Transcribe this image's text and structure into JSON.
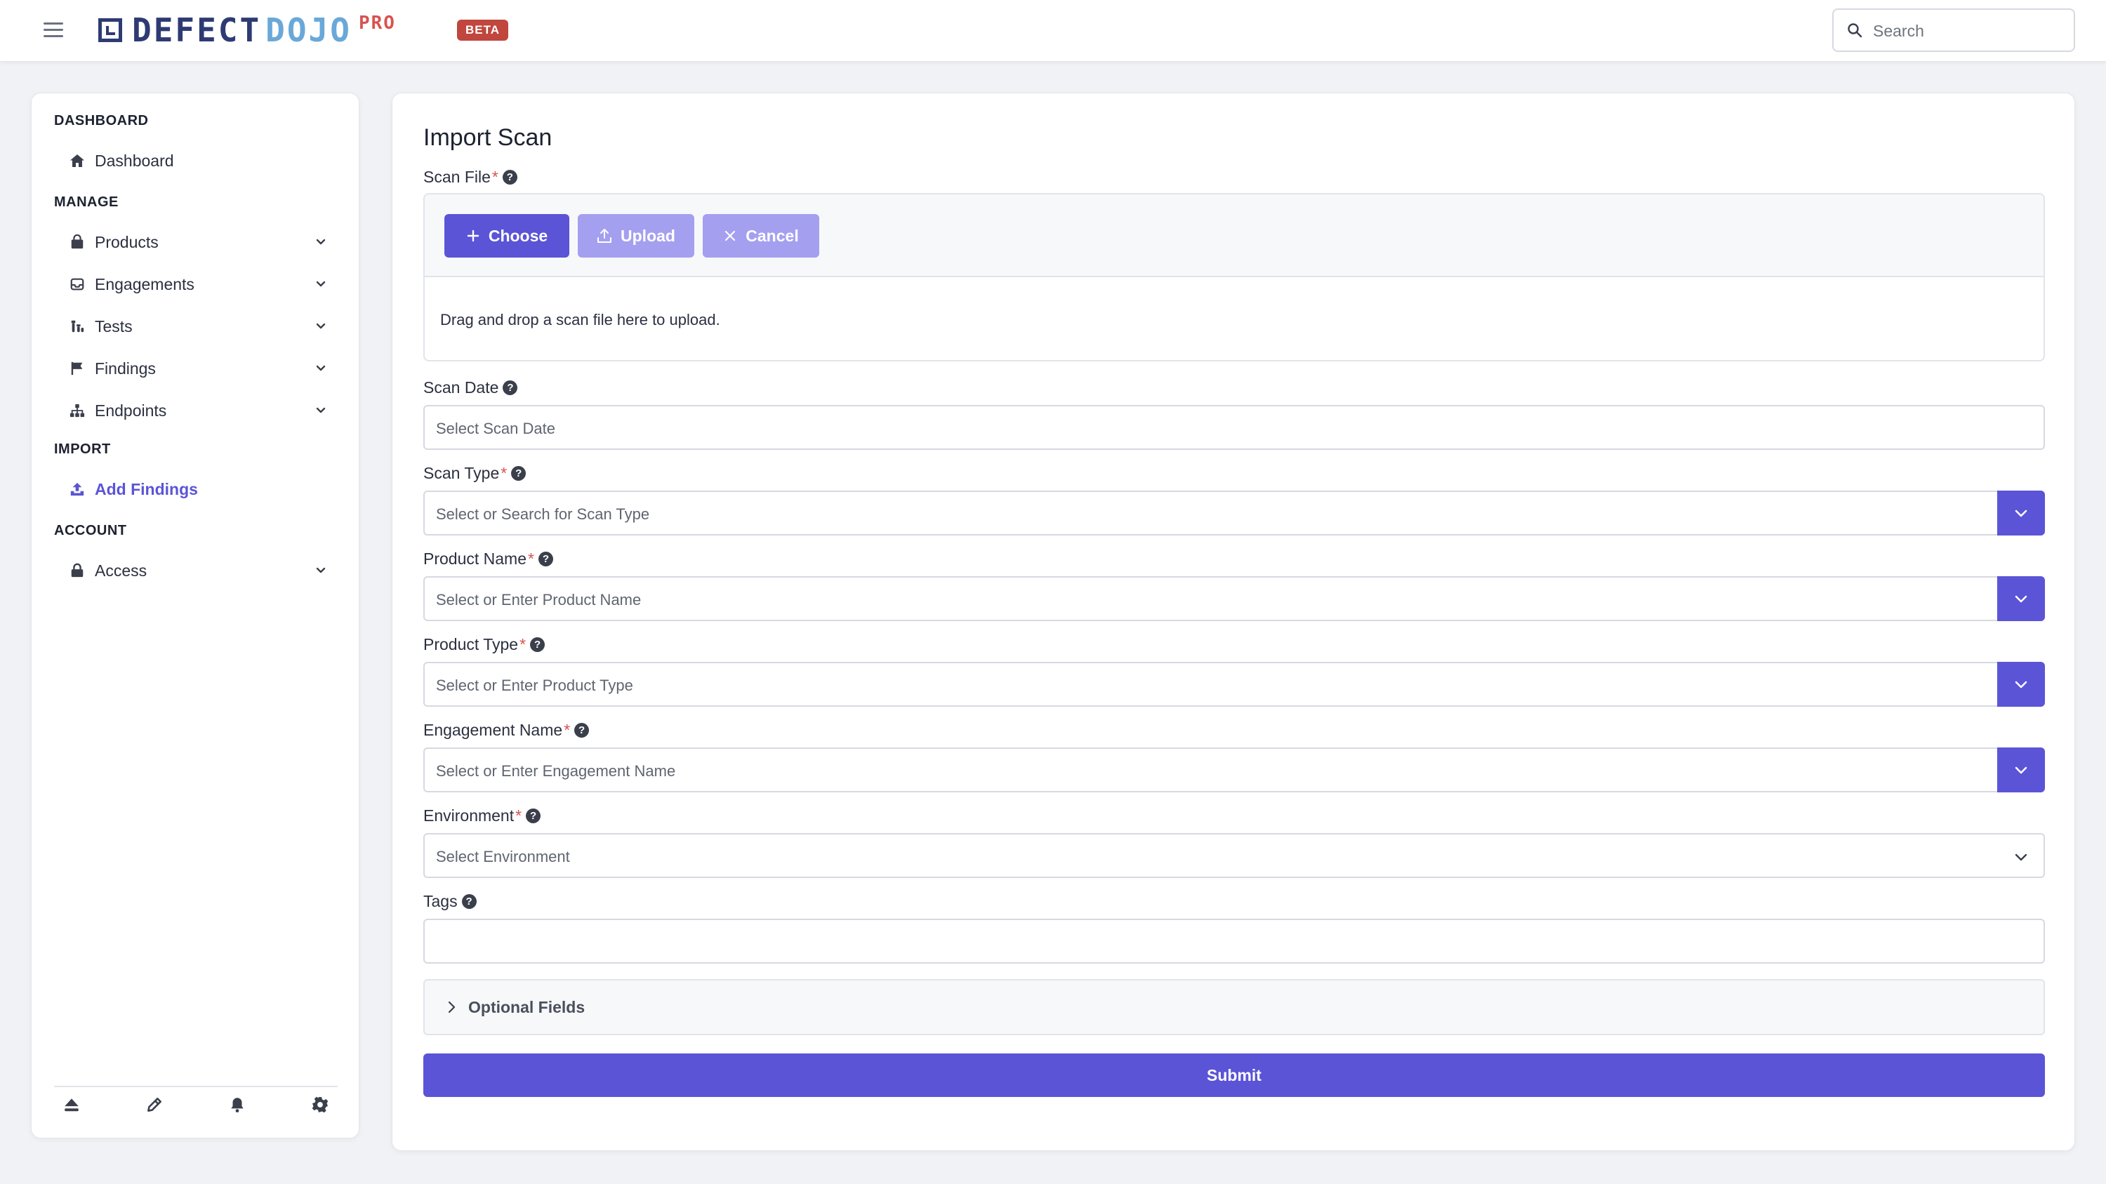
{
  "header": {
    "logo_defect": "DEFECT",
    "logo_dojo": "DOJO",
    "logo_pro": "PRO",
    "beta_badge": "BETA",
    "search_placeholder": "Search"
  },
  "sidebar": {
    "sections": {
      "dashboard": "DASHBOARD",
      "manage": "MANAGE",
      "import": "IMPORT",
      "account": "ACCOUNT"
    },
    "items": {
      "dashboard": "Dashboard",
      "products": "Products",
      "engagements": "Engagements",
      "tests": "Tests",
      "findings": "Findings",
      "endpoints": "Endpoints",
      "add_findings": "Add Findings",
      "access": "Access"
    },
    "footer_icons": [
      "eject-icon",
      "pencil-icon",
      "bell-icon",
      "gear-icon"
    ]
  },
  "form": {
    "title": "Import Scan",
    "scan_file": {
      "label": "Scan File",
      "required": "*",
      "choose": "Choose",
      "upload": "Upload",
      "cancel": "Cancel",
      "drop_text": "Drag and drop a scan file here to upload."
    },
    "scan_date": {
      "label": "Scan Date",
      "placeholder": "Select Scan Date"
    },
    "scan_type": {
      "label": "Scan Type",
      "required": "*",
      "placeholder": "Select or Search for Scan Type"
    },
    "product_name": {
      "label": "Product Name",
      "required": "*",
      "placeholder": "Select or Enter Product Name"
    },
    "product_type": {
      "label": "Product Type",
      "required": "*",
      "placeholder": "Select or Enter Product Type"
    },
    "engagement_name": {
      "label": "Engagement Name",
      "required": "*",
      "placeholder": "Select or Enter Engagement Name"
    },
    "environment": {
      "label": "Environment",
      "required": "*",
      "placeholder": "Select Environment"
    },
    "tags": {
      "label": "Tags",
      "value": ""
    },
    "optional_fields": "Optional Fields",
    "submit": "Submit",
    "help_glyph": "?"
  },
  "colors": {
    "accent": "#5b54d6",
    "accent_light": "#a59ff0",
    "required": "#d9534f",
    "logo_dark": "#2e3b73",
    "logo_light": "#6aa8d8"
  }
}
